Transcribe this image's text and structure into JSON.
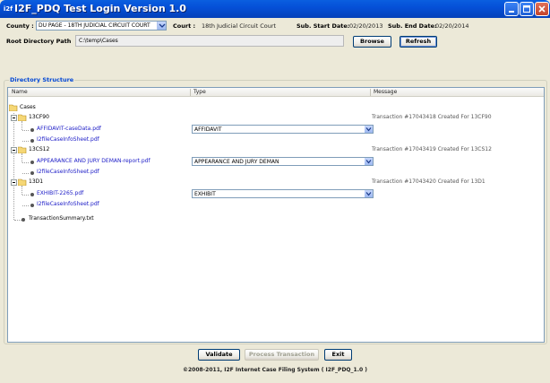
{
  "window": {
    "title": "I2F_PDQ Test Login Version 1.0",
    "icon_text": "i2f"
  },
  "form": {
    "county_label": "County :",
    "county_value": "DU PAGE - 18TH JUDICIAL CIRCUIT COURT",
    "court_label": "Court :",
    "court_value": "18th Judicial Circuit Court",
    "start_label": "Sub. Start Date:",
    "start_value": "02/20/2013",
    "end_label": "Sub. End Date:",
    "end_value": "02/20/2014",
    "root_label": "Root Directory Path",
    "root_value": "C:\\temp\\Cases",
    "browse_label": "Browse",
    "refresh_label": "Refresh"
  },
  "panel": {
    "title": "Directory Structure",
    "columns": [
      "Name",
      "Type",
      "Message"
    ]
  },
  "tree": {
    "root": "Cases",
    "cases": [
      {
        "folder": "13CF90",
        "message": "Transaction #17043418 Created For 13CF90",
        "files": [
          {
            "name": "AFFIDAVIT-caseData.pdf",
            "type": "AFFIDAVIT"
          },
          {
            "name": "I2fileCaseInfoSheet.pdf",
            "type": ""
          }
        ]
      },
      {
        "folder": "13CS12",
        "message": "Transaction #17043419 Created For 13CS12",
        "files": [
          {
            "name": "APPEARANCE AND JURY DEMAN-report.pdf",
            "type": "APPEARANCE AND JURY DEMAN"
          },
          {
            "name": "I2fileCaseInfoSheet.pdf",
            "type": ""
          }
        ]
      },
      {
        "folder": "13D1",
        "message": "Transaction #17043420 Created For 13D1",
        "files": [
          {
            "name": "EXHIBIT-2265.pdf",
            "type": "EXHIBIT"
          },
          {
            "name": "I2fileCaseInfoSheet.pdf",
            "type": ""
          }
        ]
      }
    ],
    "summary_file": "TransactionSummary.txt"
  },
  "actions": {
    "validate_label": "Validate",
    "process_label": "Process Transaction",
    "exit_label": "Exit"
  },
  "footer": {
    "copyright": "©2008-2011, I2F Internet Case Filing System ( I2F_PDQ_1.0 )"
  },
  "colors": {
    "titlebar": "#0550d8",
    "window_bg": "#ece9d8",
    "link": "#2020c8",
    "panel_title": "#0046d5"
  }
}
